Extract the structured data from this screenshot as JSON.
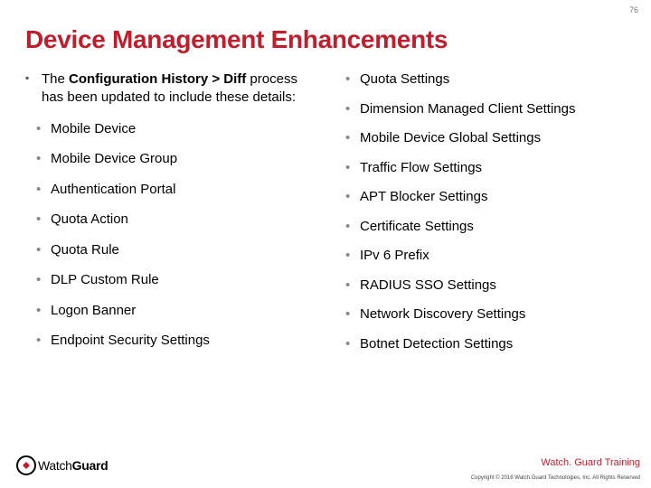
{
  "page_number": "76",
  "title": "Device Management Enhancements",
  "lead_prefix": "The ",
  "lead_bold": "Configuration History > Diff",
  "lead_suffix": " process has been updated to include these details:",
  "left_items": [
    "Mobile Device",
    "Mobile Device Group",
    "Authentication Portal",
    "Quota Action",
    "Quota Rule",
    "DLP Custom Rule",
    "Logon Banner",
    "Endpoint Security Settings"
  ],
  "right_items": [
    "Quota Settings",
    "Dimension Managed Client Settings",
    "Mobile Device Global Settings",
    "Traffic Flow Settings",
    "APT Blocker Settings",
    "Certificate Settings",
    "IPv 6 Prefix",
    "RADIUS SSO Settings",
    "Network Discovery Settings",
    "Botnet Detection Settings"
  ],
  "logo_thin": "Watch",
  "logo_bold": "Guard",
  "training_label": "Watch. Guard Training",
  "copyright": "Copyright © 2016 Watch.Guard Technologies, Inc. All Rights Reserved"
}
